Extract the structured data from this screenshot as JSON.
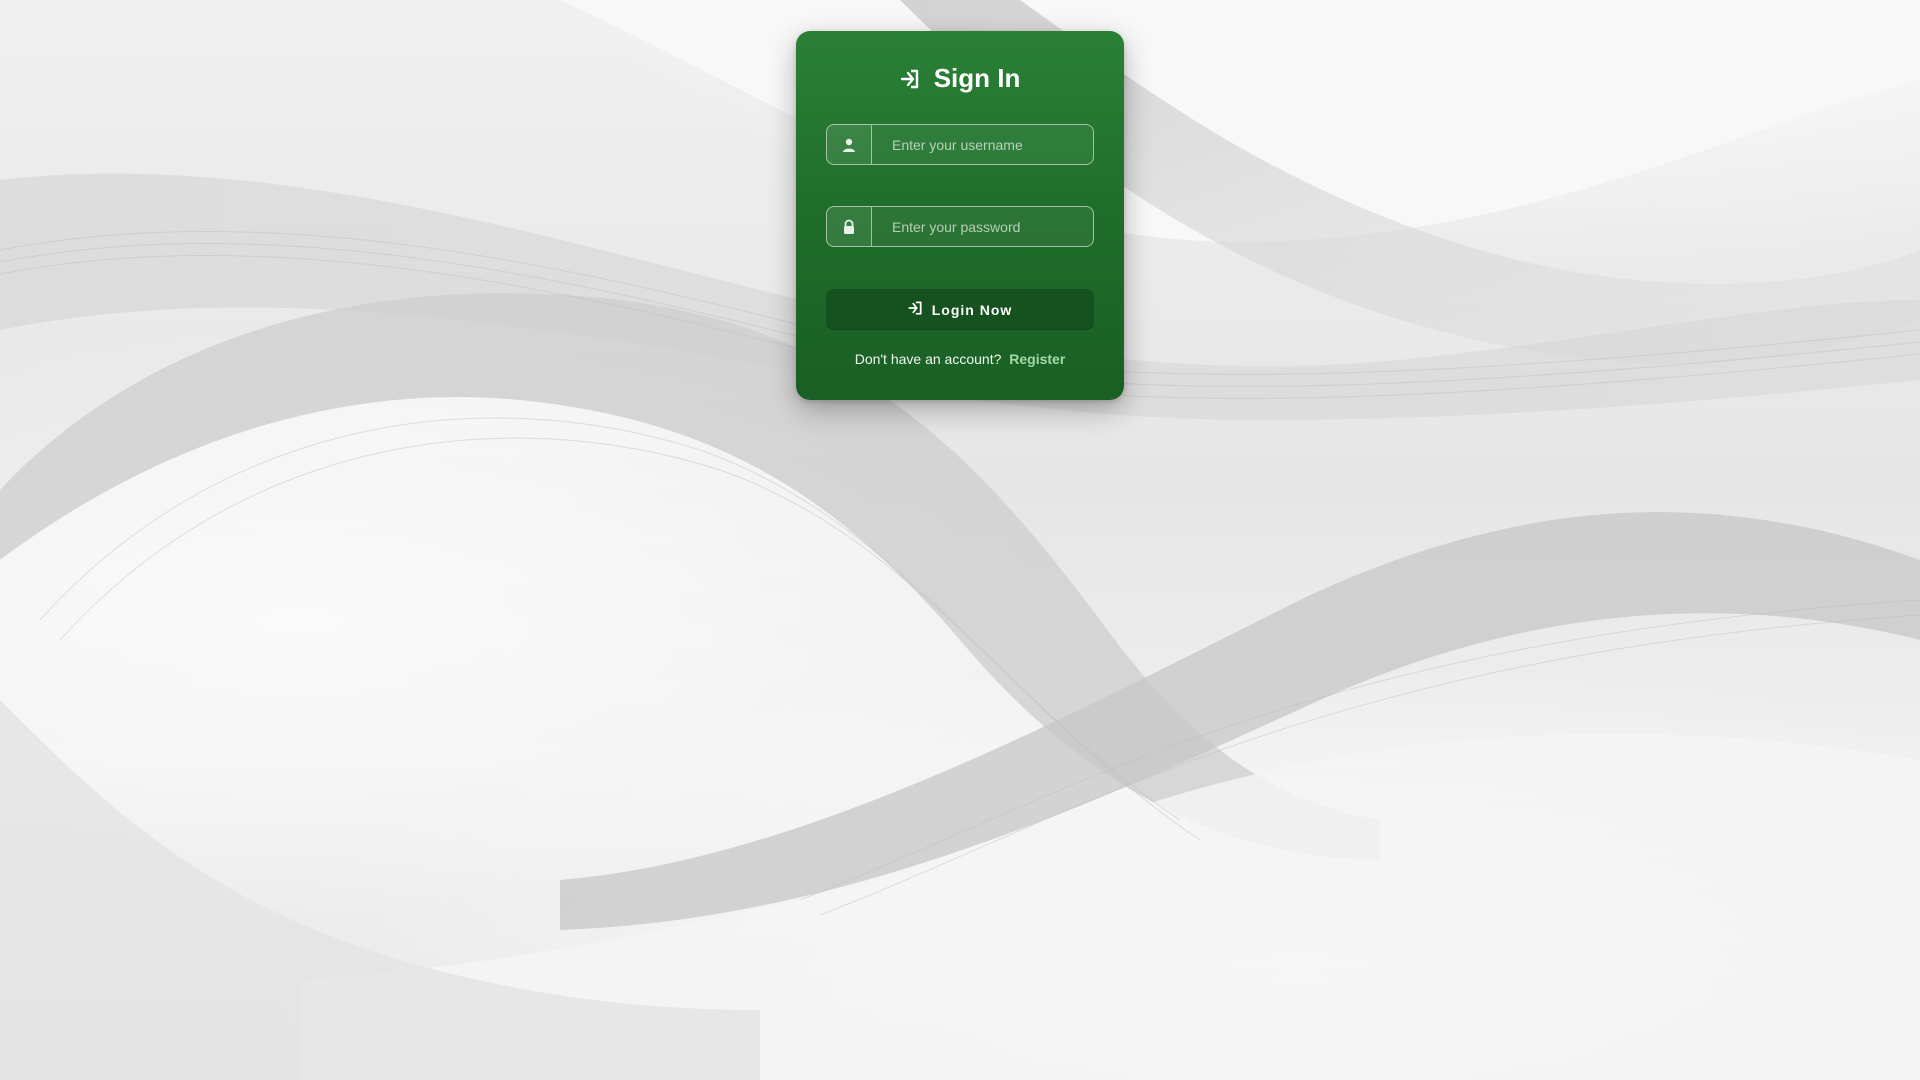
{
  "colors": {
    "card_top": "#2a8035",
    "card_bottom": "#1a5f24",
    "button": "#155220",
    "link": "#a6d9a9"
  },
  "login": {
    "title_icon": "sign-in-icon",
    "title": "Sign In",
    "username": {
      "icon": "user-icon",
      "value": "",
      "placeholder": "Enter your username"
    },
    "password": {
      "icon": "lock-icon",
      "value": "",
      "placeholder": "Enter your password"
    },
    "submit": {
      "icon": "sign-in-icon",
      "label": "Login Now"
    },
    "register": {
      "prompt": "Don't have an account?",
      "link": "Register"
    }
  }
}
